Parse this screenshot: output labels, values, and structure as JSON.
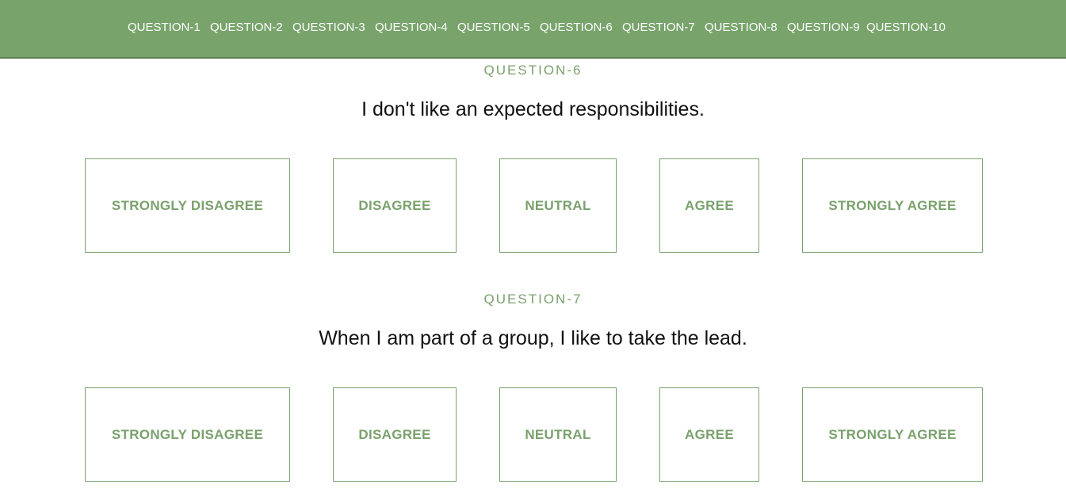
{
  "nav": {
    "items": [
      {
        "label": "QUESTION-1"
      },
      {
        "label": "QUESTION-2"
      },
      {
        "label": "QUESTION-3"
      },
      {
        "label": "QUESTION-4"
      },
      {
        "label": "QUESTION-5"
      },
      {
        "label": "QUESTION-6"
      },
      {
        "label": "QUESTION-7"
      },
      {
        "label": "QUESTION-8"
      },
      {
        "label": "QUESTION-9"
      },
      {
        "label": "QUESTION-10"
      }
    ]
  },
  "questions": [
    {
      "label": "QUESTION-6",
      "text": "I don't like an expected responsibilities.",
      "options": [
        "STRONGLY DISAGREE",
        "DISAGREE",
        "NEUTRAL",
        "AGREE",
        "STRONGLY AGREE"
      ]
    },
    {
      "label": "QUESTION-7",
      "text": "When I am part of a group, I like to take the lead.",
      "options": [
        "STRONGLY DISAGREE",
        "DISAGREE",
        "NEUTRAL",
        "AGREE",
        "STRONGLY AGREE"
      ]
    }
  ],
  "colors": {
    "nav_background": "#78a46c",
    "accent": "#7aa16d",
    "question_text": "#111111"
  }
}
